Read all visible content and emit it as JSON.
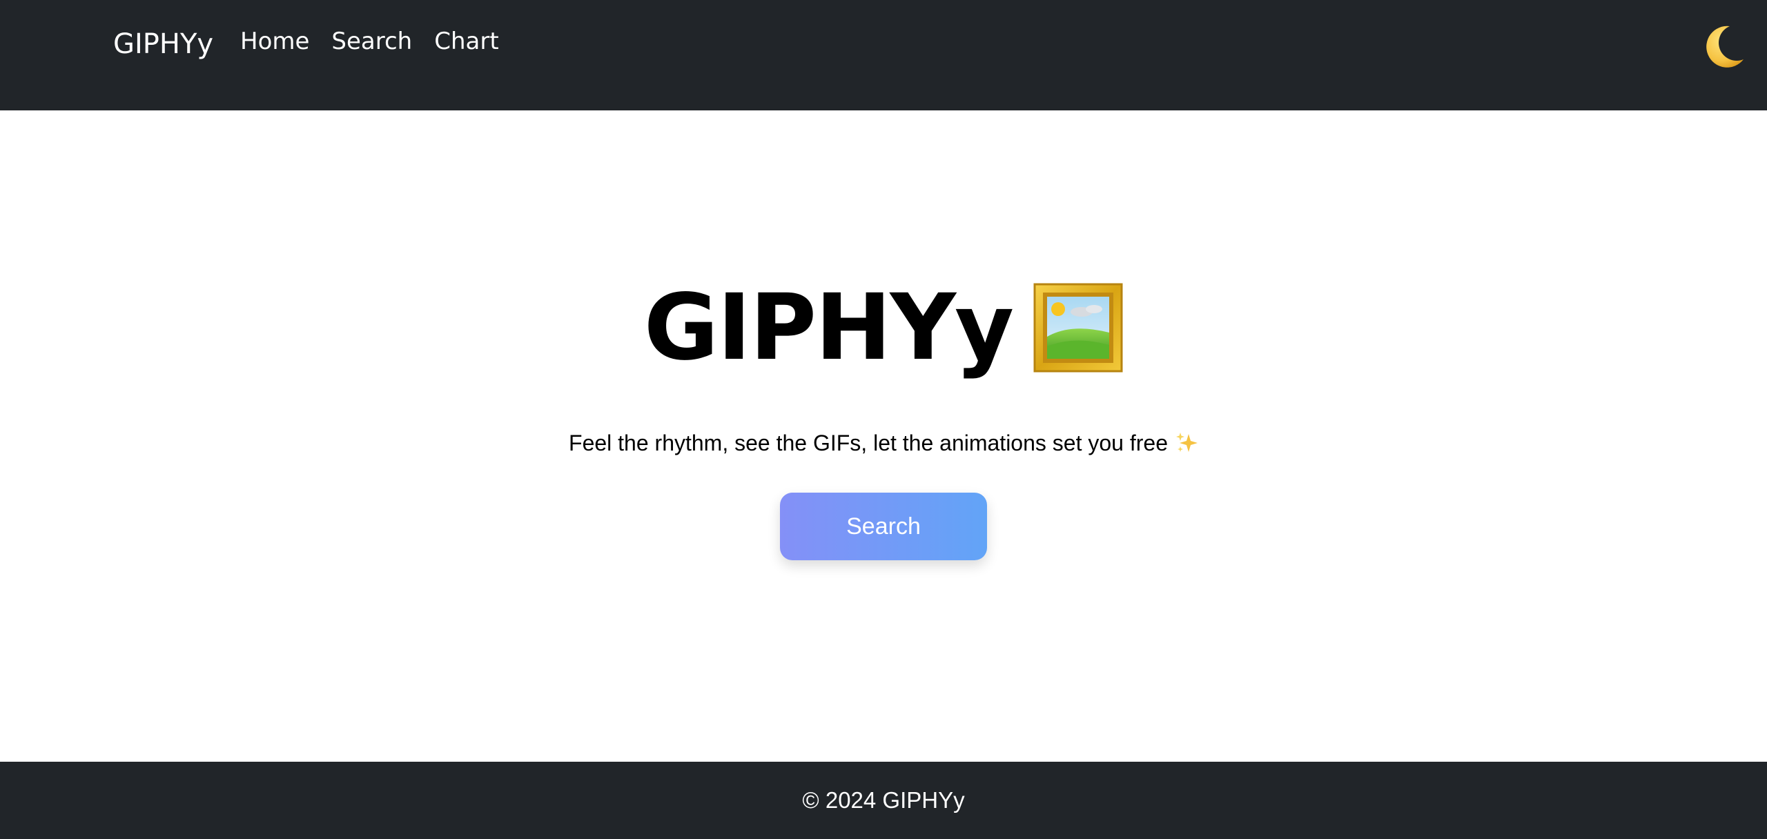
{
  "navbar": {
    "brand": "GIPHYy",
    "links": [
      "Home",
      "Search",
      "Chart"
    ],
    "theme_toggle_icon": "crescent-moon-icon"
  },
  "hero": {
    "title": "GIPHYy",
    "title_icon": "framed-picture-icon",
    "tagline": "Feel the rhythm, see the GIFs, let the animations set you free",
    "tagline_icon": "sparkles-icon",
    "button_label": "Search"
  },
  "footer": {
    "text": "© 2024 GIPHYy"
  },
  "colors": {
    "navbar_bg": "#212529",
    "button_gradient_start": "#8490f7",
    "button_gradient_end": "#62a4f7",
    "moon": "#f5c242"
  }
}
